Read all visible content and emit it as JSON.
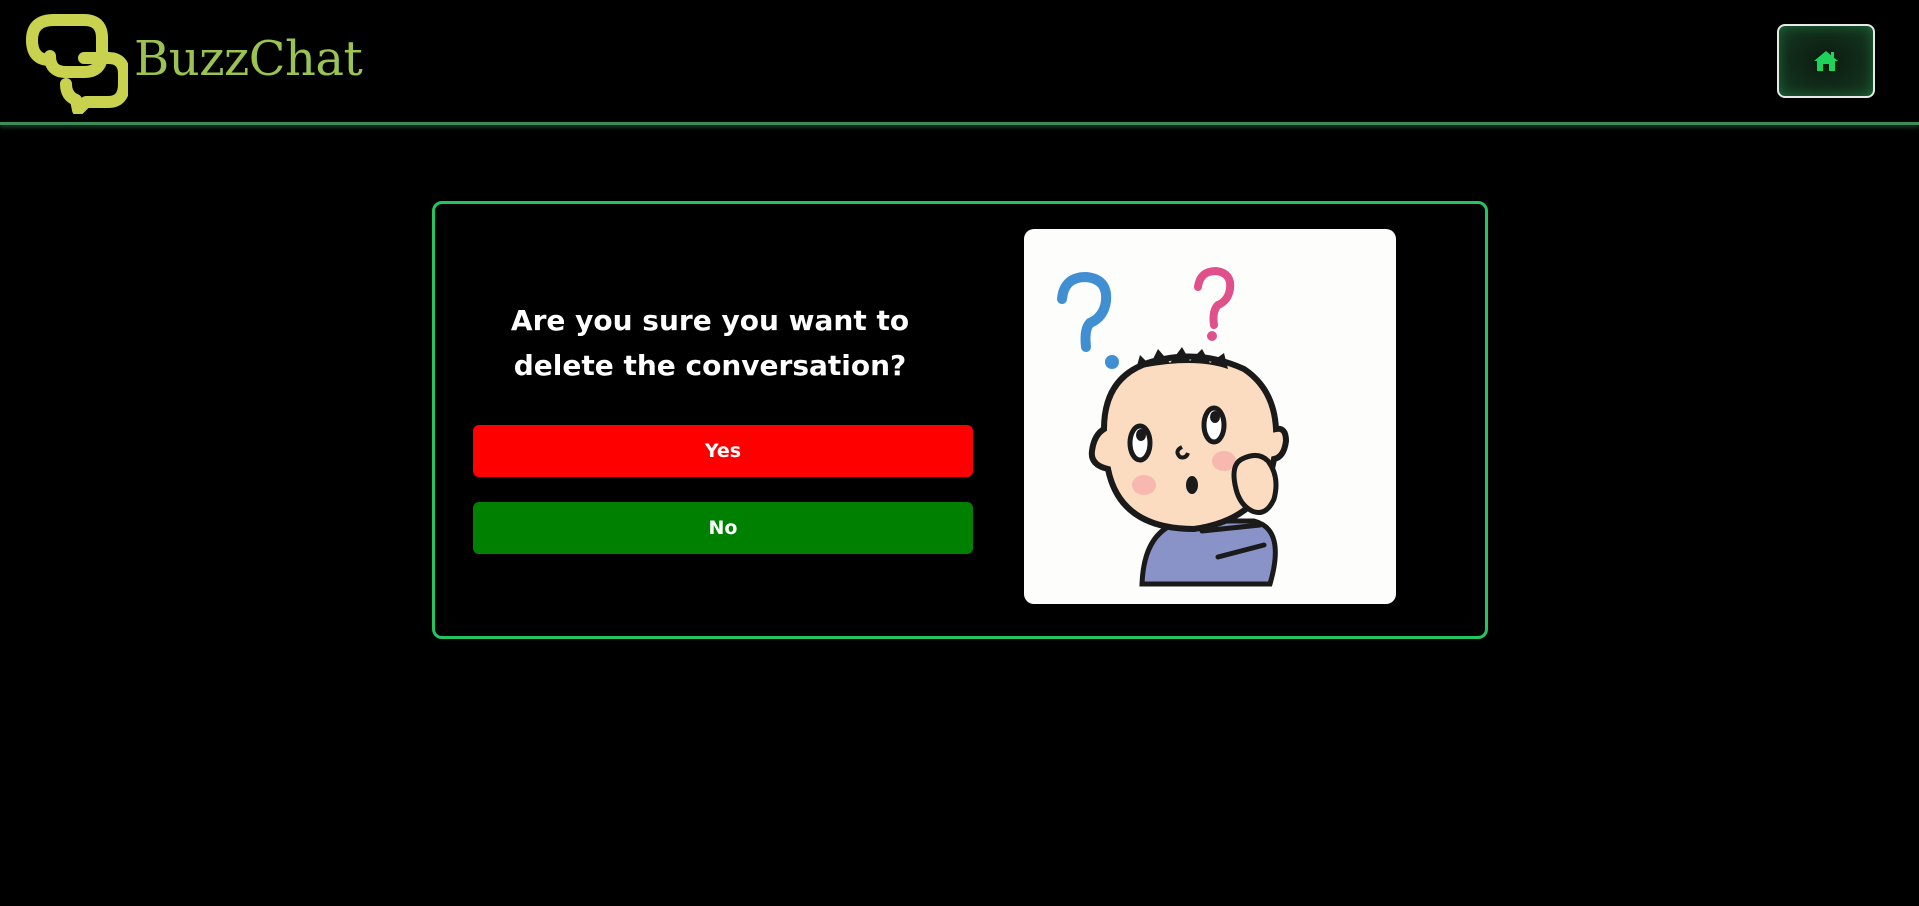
{
  "brand": {
    "name": "BuzzChat",
    "color": "#9bc353"
  },
  "header": {
    "home_icon": "home-icon",
    "accent": "#22c55e"
  },
  "dialog": {
    "question": "Are you sure you want to delete the conversation?",
    "yes_label": "Yes",
    "no_label": "No",
    "yes_color": "#ff0000",
    "no_color": "#008000",
    "border_color": "#22c55e",
    "illustration": "confused-boy-icon"
  }
}
